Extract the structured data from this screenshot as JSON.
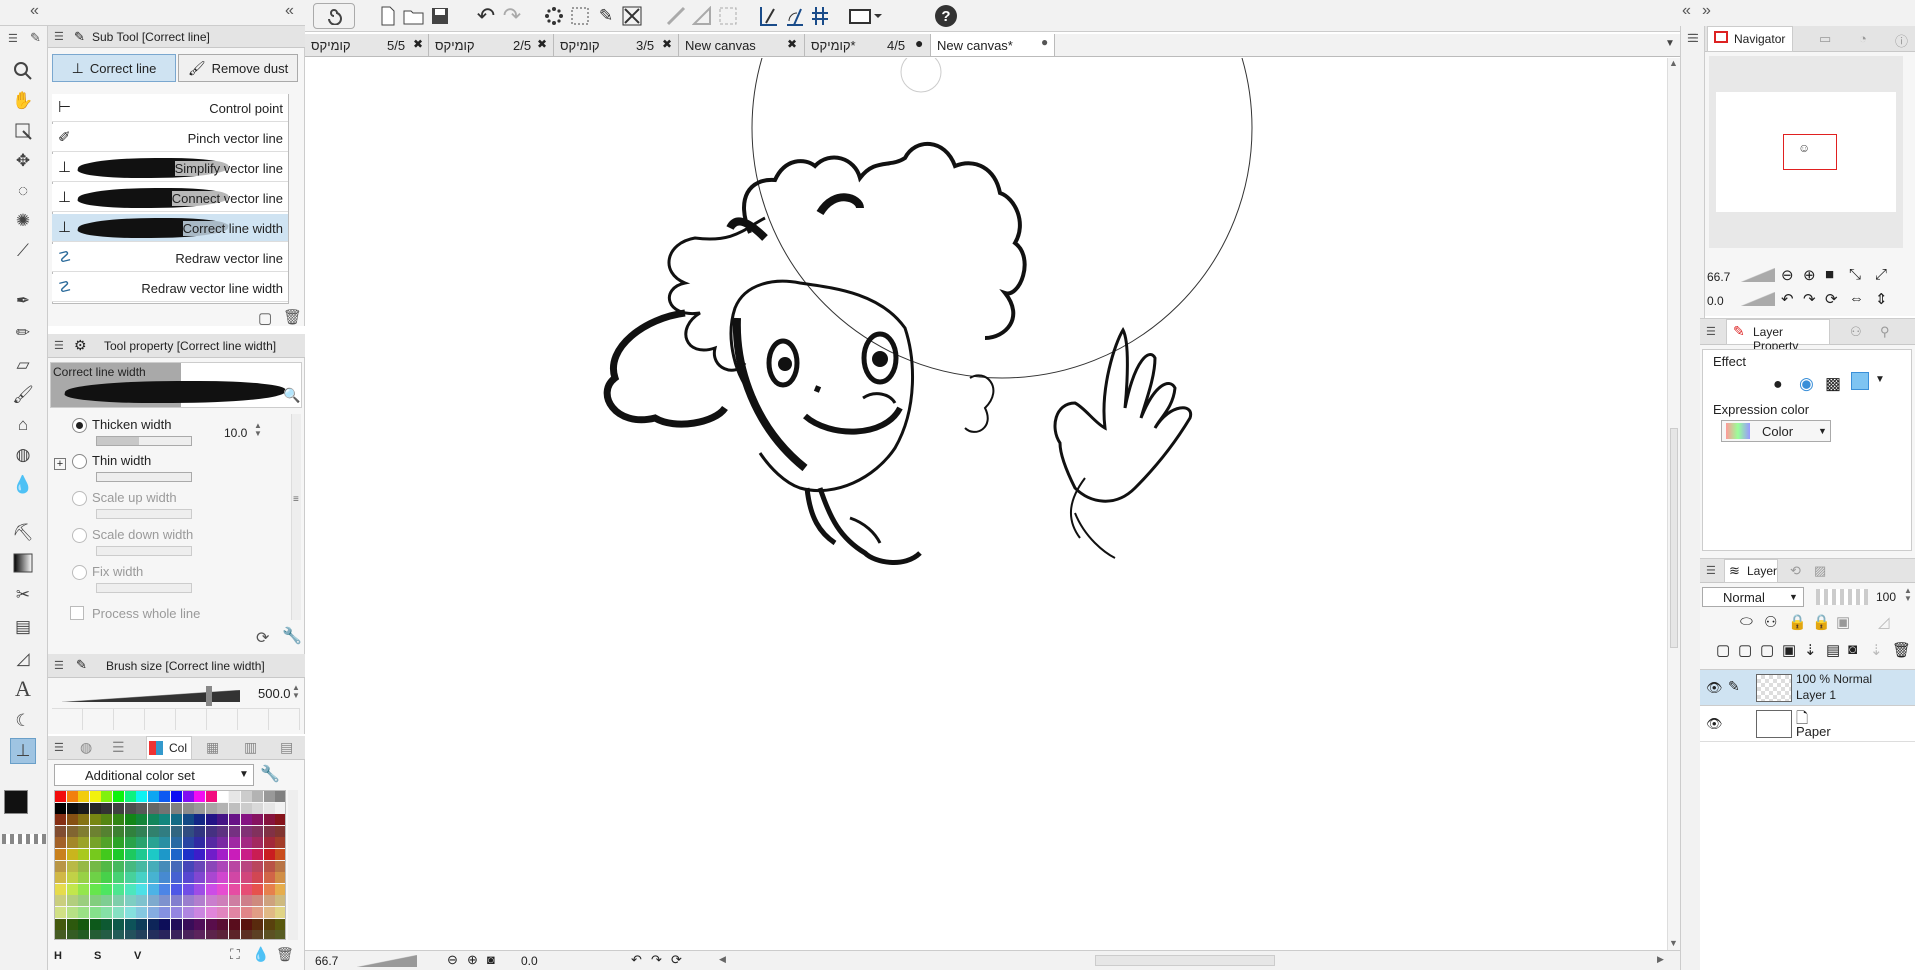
{
  "toolbar": {
    "icons": [
      "swirl-icon",
      "new-file-icon",
      "open-folder-icon",
      "save-icon",
      "undo-icon",
      "redo-icon",
      "transform-icon",
      "select-all-icon",
      "pen-settings-icon",
      "cross-icon",
      "ruler-off-icon",
      "ruler-guide-icon",
      "grid-icon",
      "ruler-snap-icon",
      "perspective-icon",
      "snap-grid-icon",
      "screen-icon",
      "help-icon"
    ]
  },
  "tabs": [
    {
      "title": "קומיקס",
      "page": "5/5",
      "state": "close"
    },
    {
      "title": "קומיקס",
      "page": "2/5",
      "state": "close"
    },
    {
      "title": "קומיקס",
      "page": "3/5",
      "state": "close"
    },
    {
      "title": "New canvas",
      "page": "",
      "state": "close"
    },
    {
      "title": "קומיקס*",
      "page": "4/5",
      "state": "dot"
    },
    {
      "title": "New canvas*",
      "page": "",
      "state": "dot"
    }
  ],
  "subtool": {
    "header": "Sub Tool [Correct line]",
    "tab_correct": "Correct line",
    "tab_remove": "Remove dust",
    "items": [
      "Control point",
      "Pinch vector line",
      "Simplify vector line",
      "Connect vector line",
      "Correct line width",
      "Redraw vector line",
      "Redraw vector line width"
    ],
    "selected_index": 4
  },
  "toolprop": {
    "header": "Tool property [Correct line width]",
    "preview_label": "Correct line width",
    "options": [
      {
        "label": "Thicken width",
        "value": "10.0",
        "checked": true,
        "enabled": true
      },
      {
        "label": "Thin width",
        "value": "",
        "checked": false,
        "enabled": true
      },
      {
        "label": "Scale up width",
        "value": "",
        "checked": false,
        "enabled": false
      },
      {
        "label": "Scale down width",
        "value": "",
        "checked": false,
        "enabled": false
      },
      {
        "label": "Fix width",
        "value": "",
        "checked": false,
        "enabled": false
      }
    ],
    "process_whole_line": "Process whole line"
  },
  "brushsize": {
    "header": "Brush size [Correct line width]",
    "value": "500.0"
  },
  "colorset": {
    "tab_short": "Col",
    "set_name": "Additional color set",
    "hsv": [
      "H",
      "S",
      "V"
    ]
  },
  "status": {
    "zoom": "66.7",
    "rotation": "0.0"
  },
  "navigator": {
    "title": "Navigator",
    "zoom": "66.7",
    "angle": "0.0"
  },
  "layerprop": {
    "title": "Layer Property",
    "effect": "Effect",
    "expression_color": "Expression color",
    "color_mode": "Color"
  },
  "layers": {
    "title": "Layer",
    "blend": "Normal",
    "opacity": "100",
    "items": [
      {
        "mode": "100 % Normal",
        "name": "Layer 1",
        "selected": true
      },
      {
        "mode": "",
        "name": "Paper",
        "selected": false
      }
    ]
  },
  "colors": {
    "accent": "#cfe3f2",
    "main_color": "#111111",
    "red_frame": "#e02020"
  }
}
